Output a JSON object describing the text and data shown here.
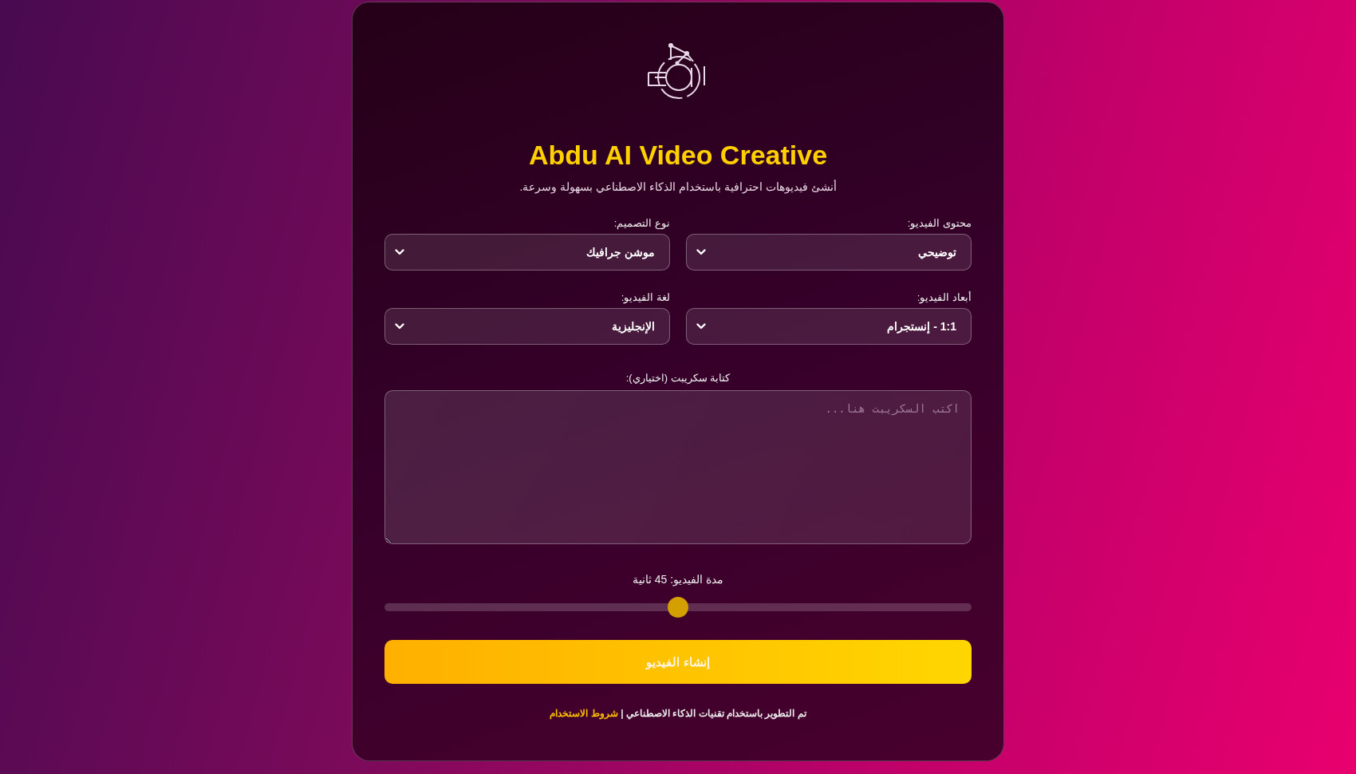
{
  "header": {
    "title": "Abdu AI Video Creative",
    "subtitle": "أنشئ فيديوهات احترافية باستخدام الذكاء الاصطناعي بسهولة وسرعة."
  },
  "fields": [
    {
      "label": "محتوى الفيديو:",
      "value": "توضيحي"
    },
    {
      "label": "نوع التصميم:",
      "value": "موشن جرافيك"
    },
    {
      "label": "أبعاد الفيديو:",
      "value": "1:1 - إنستجرام"
    },
    {
      "label": "لغة الفيديو:",
      "value": "الإنجليزية"
    }
  ],
  "script": {
    "label": "كتابة سكريبت (اختياري):",
    "placeholder": "اكتب السكريبت هنا..."
  },
  "duration": {
    "label": "مدة الفيديو: 45 ثانية",
    "level": 0.5
  },
  "submit": "إنشاء الفيديو",
  "footer": {
    "text": "تم التطوير باستخدام تقنيات الذكاء الاصطناعي |",
    "link": "شروط الاستخدام"
  }
}
